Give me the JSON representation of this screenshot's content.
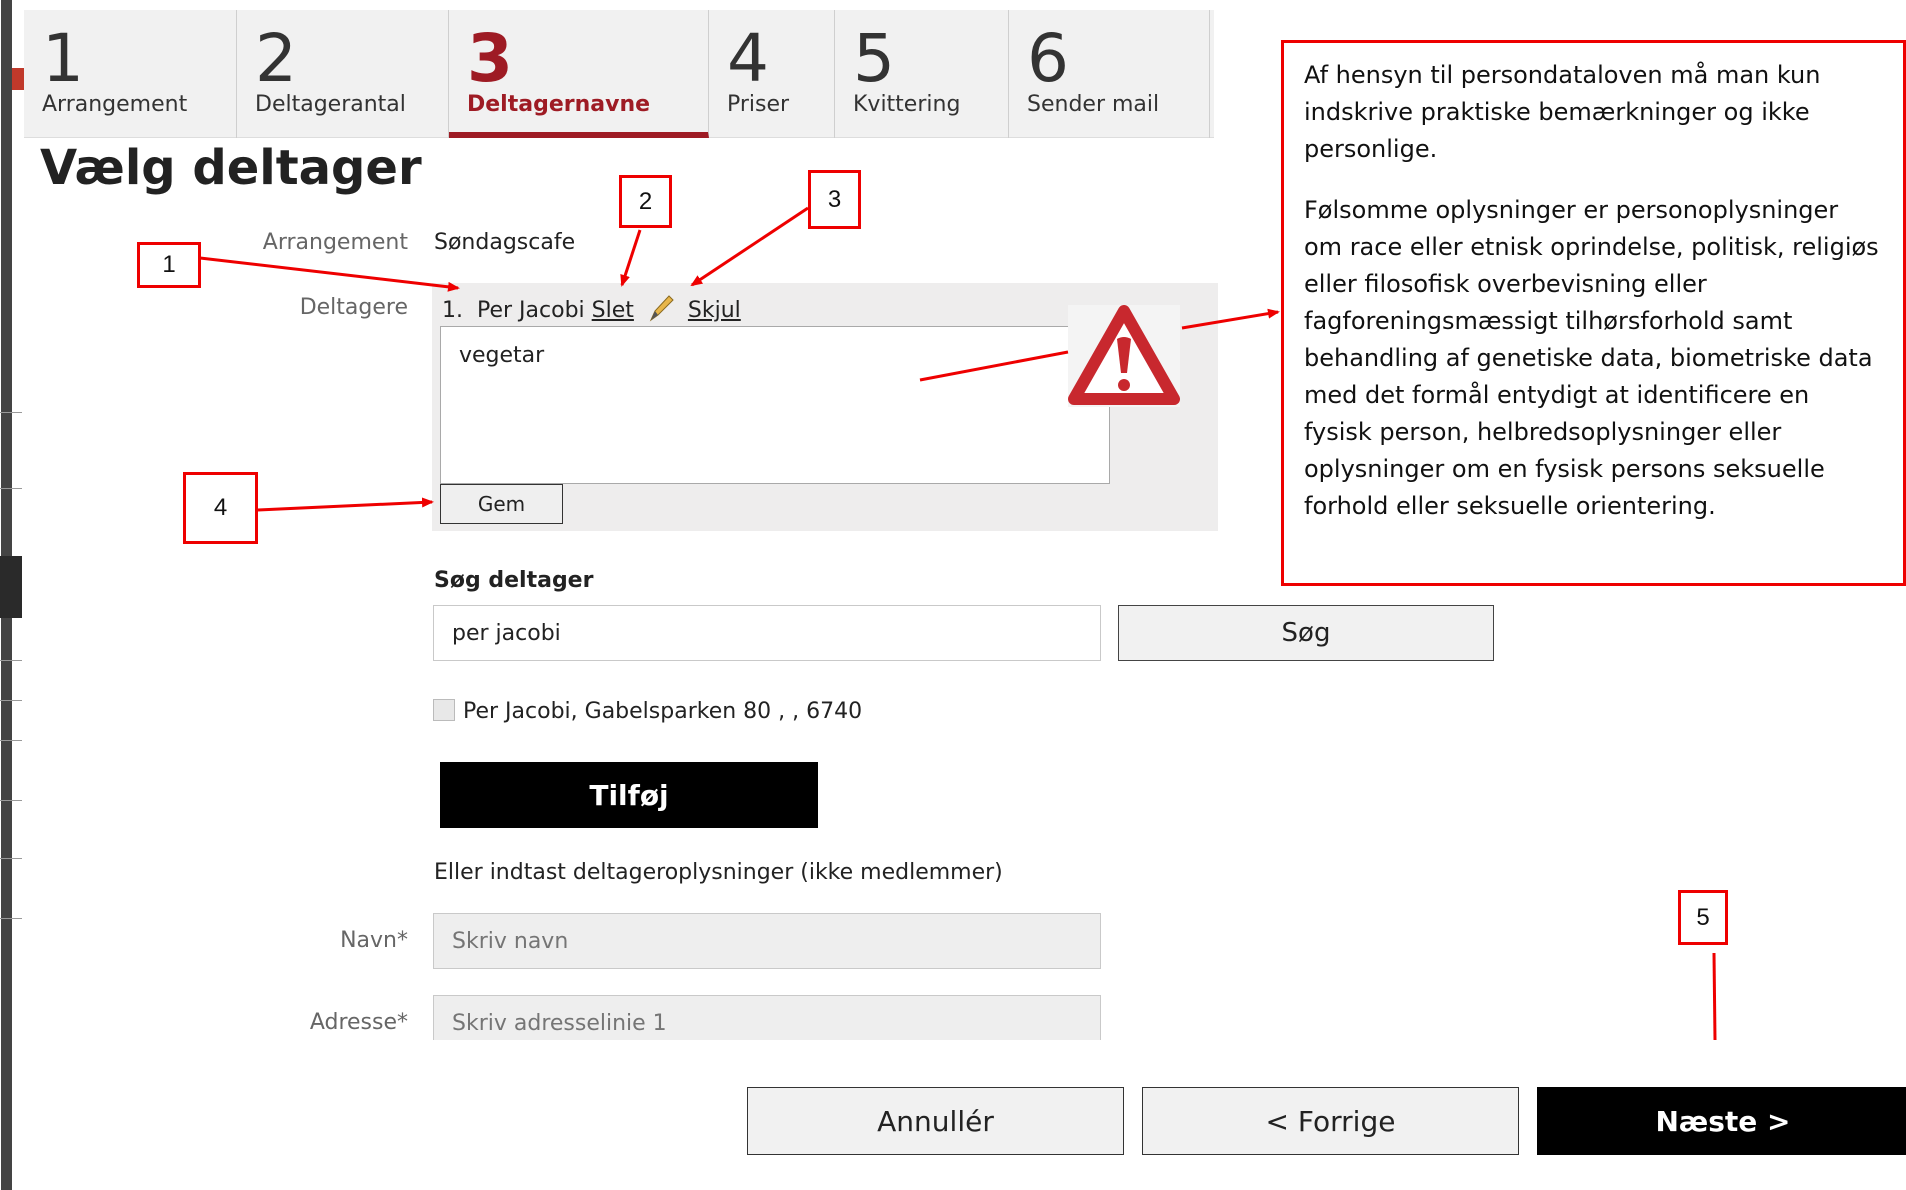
{
  "steps": [
    {
      "num": "1",
      "label": "Arrangement"
    },
    {
      "num": "2",
      "label": "Deltagerantal"
    },
    {
      "num": "3",
      "label": "Deltagernavne"
    },
    {
      "num": "4",
      "label": "Priser"
    },
    {
      "num": "5",
      "label": "Kvittering"
    },
    {
      "num": "6",
      "label": "Sender mail"
    }
  ],
  "page": {
    "title": "Vælg deltager"
  },
  "event": {
    "label": "Arrangement",
    "value": "Søndagscafe"
  },
  "participants": {
    "label": "Deltagere",
    "index": "1.",
    "name": "Per Jacobi",
    "delete_link": "Slet",
    "hide_link": "Skjul",
    "note_value": "vegetar",
    "save_button": "Gem"
  },
  "search": {
    "heading": "Søg deltager",
    "value": "per jacobi",
    "button": "Søg"
  },
  "result": {
    "text": "Per Jacobi, Gabelsparken 80 , , 6740",
    "checked": false
  },
  "add_button": "Tilføj",
  "manual": {
    "hint": "Eller indtast deltageroplysninger (ikke medlemmer)",
    "name_label": "Navn*",
    "name_placeholder": "Skriv navn",
    "address_label": "Adresse*",
    "address_placeholder": "Skriv adresselinie 1"
  },
  "footer": {
    "cancel": "Annullér",
    "previous": "< Forrige",
    "next": "Næste >"
  },
  "info": {
    "paragraph1": "Af hensyn til persondataloven må man kun indskrive praktiske bemærkninger og ikke personlige.",
    "paragraph2": "Følsomme oplysninger er personoplysninger om race eller etnisk oprindelse, politisk, religiøs eller filosofisk overbevisning eller fagforeningsmæssigt tilhørsforhold samt behandling af genetiske data, biometriske data med det formål entydigt at identificere en fysisk person, helbredsoplysninger eller oplysninger om en fysisk persons seksuelle forhold eller seksuelle orientering."
  },
  "callouts": [
    "1",
    "2",
    "3",
    "4",
    "5"
  ],
  "colors": {
    "accent": "#9e1b24",
    "annotation": "#e00000",
    "primary_button": "#000000"
  }
}
